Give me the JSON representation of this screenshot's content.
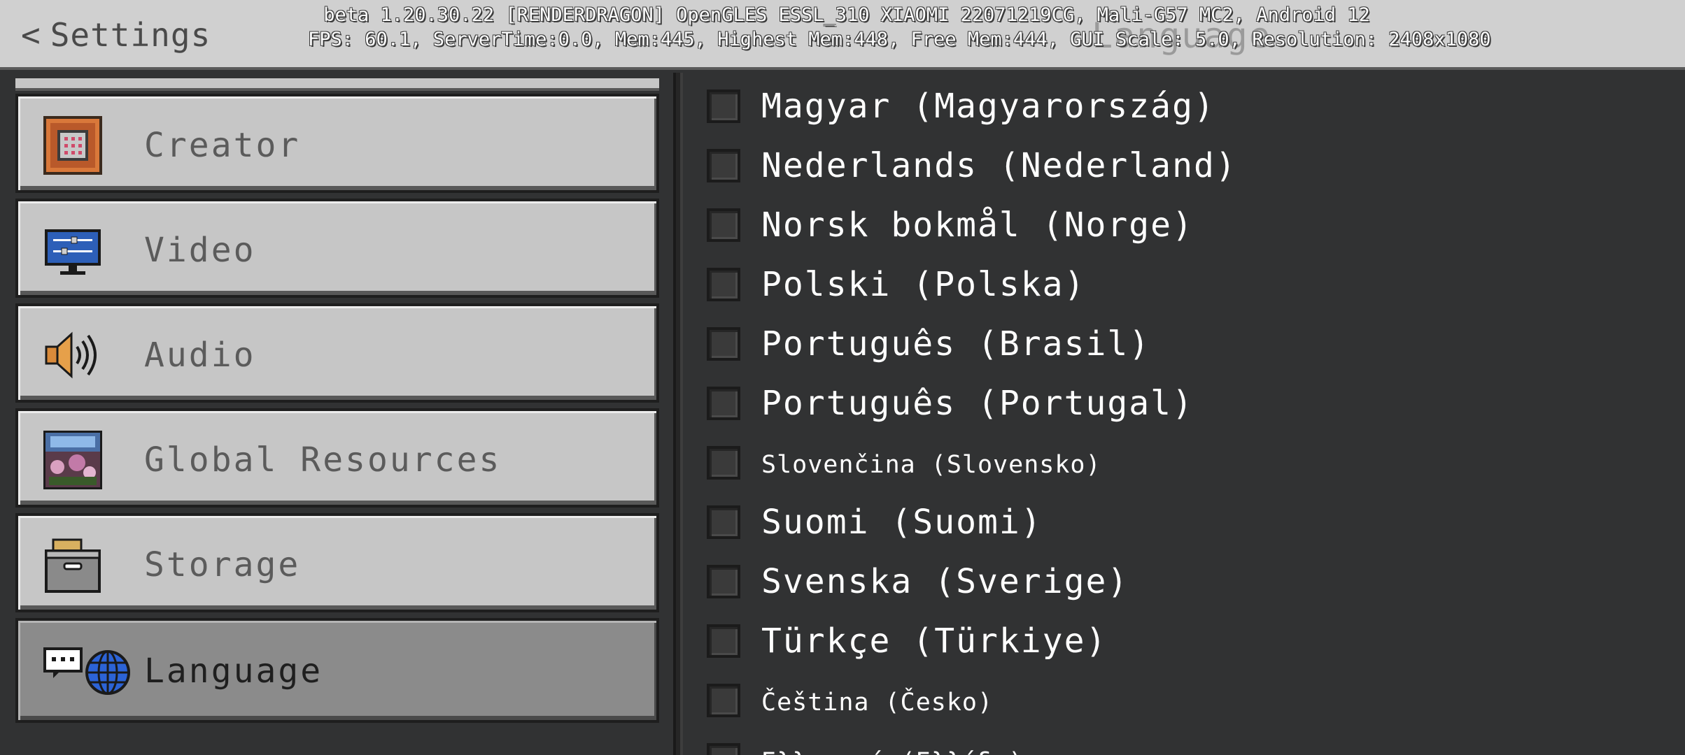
{
  "header": {
    "back_label": "Settings",
    "title": "Language",
    "debug_line1": "beta 1.20.30.22 [RENDERDRAGON] OpenGLES ESSL_310 XIAOMI 22071219CG, Mali-G57 MC2, Android 12",
    "debug_line2": "FPS: 60.1, ServerTime:0.0, Mem:445, Highest Mem:448, Free Mem:444, GUI Scale: 5.0, Resolution: 2408x1080"
  },
  "sidebar": {
    "items": [
      {
        "label": "Creator",
        "icon": "command-block-icon"
      },
      {
        "label": "Video",
        "icon": "monitor-sliders-icon"
      },
      {
        "label": "Audio",
        "icon": "speaker-icon"
      },
      {
        "label": "Global Resources",
        "icon": "resource-pack-icon"
      },
      {
        "label": "Storage",
        "icon": "storage-box-icon"
      },
      {
        "label": "Language",
        "icon": "chat-globe-icon",
        "selected": true
      }
    ]
  },
  "languages": [
    {
      "label": "Magyar (Magyarország)",
      "checked": false
    },
    {
      "label": "Nederlands (Nederland)",
      "checked": false
    },
    {
      "label": "Norsk bokmål (Norge)",
      "checked": false
    },
    {
      "label": "Polski (Polska)",
      "checked": false
    },
    {
      "label": "Português (Brasil)",
      "checked": false
    },
    {
      "label": "Português (Portugal)",
      "checked": false
    },
    {
      "label": "Slovenčina (Slovensko)",
      "checked": false
    },
    {
      "label": "Suomi (Suomi)",
      "checked": false
    },
    {
      "label": "Svenska (Sverige)",
      "checked": false
    },
    {
      "label": "Türkçe (Türkiye)",
      "checked": false
    },
    {
      "label": "Čeština (Česko)",
      "checked": false
    },
    {
      "label": "Ελληνικά (Ελλάδα)",
      "checked": false
    }
  ],
  "colors": {
    "background": "#313233",
    "panel": "#c6c6c6",
    "panel_selected": "#8b8b8b",
    "header": "#d0d0d0"
  }
}
